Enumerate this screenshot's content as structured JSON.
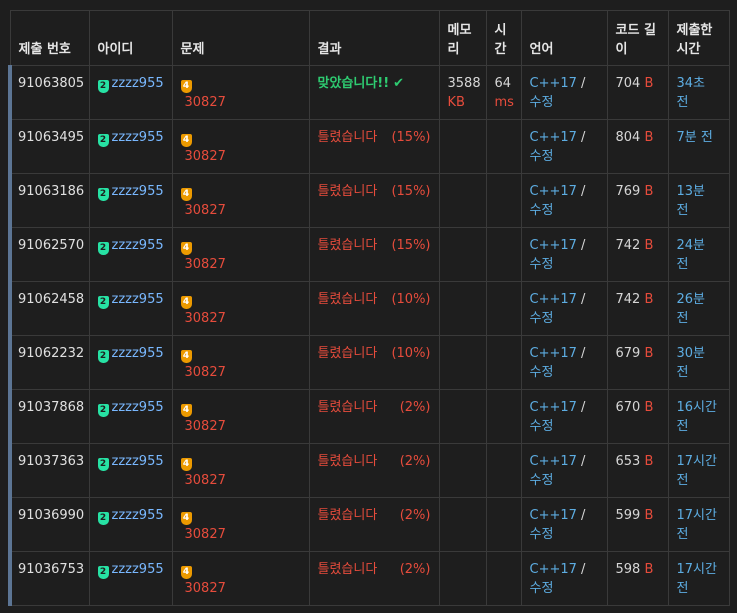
{
  "headers": {
    "submission_id": "제출 번호",
    "user_id": "아이디",
    "problem": "문제",
    "result": "결과",
    "memory": "메모리",
    "time": "시간",
    "language": "언어",
    "code_length": "코드 길이",
    "submitted_at": "제출한 시간"
  },
  "colors": {
    "accepted": "#2ecc71",
    "wrong": "#e74c3c",
    "link": "#79b8ff",
    "user_tier": "#27e2a4",
    "problem_tier": "#ec9a00",
    "row_marker": "#5c7594"
  },
  "rows": [
    {
      "id": "91063805",
      "tier": "2",
      "user": "zzzz955",
      "ptier": "4",
      "problem": "30827",
      "result": "맞았습니다!!",
      "ok": true,
      "pct": "",
      "mem": "3588",
      "mem_unit": "KB",
      "time": "64",
      "time_unit": "ms",
      "lang": "C++17",
      "sep": " / ",
      "edit": "수정",
      "len": "704",
      "unit": "B",
      "ago": "34초 전"
    },
    {
      "id": "91063495",
      "tier": "2",
      "user": "zzzz955",
      "ptier": "4",
      "problem": "30827",
      "result": "틀렸습니다",
      "ok": false,
      "pct": "(15%)",
      "mem": "",
      "mem_unit": "",
      "time": "",
      "time_unit": "",
      "lang": "C++17",
      "sep": " / ",
      "edit": "수정",
      "len": "804",
      "unit": "B",
      "ago": "7분 전"
    },
    {
      "id": "91063186",
      "tier": "2",
      "user": "zzzz955",
      "ptier": "4",
      "problem": "30827",
      "result": "틀렸습니다",
      "ok": false,
      "pct": "(15%)",
      "mem": "",
      "mem_unit": "",
      "time": "",
      "time_unit": "",
      "lang": "C++17",
      "sep": " / ",
      "edit": "수정",
      "len": "769",
      "unit": "B",
      "ago": "13분 전"
    },
    {
      "id": "91062570",
      "tier": "2",
      "user": "zzzz955",
      "ptier": "4",
      "problem": "30827",
      "result": "틀렸습니다",
      "ok": false,
      "pct": "(15%)",
      "mem": "",
      "mem_unit": "",
      "time": "",
      "time_unit": "",
      "lang": "C++17",
      "sep": " / ",
      "edit": "수정",
      "len": "742",
      "unit": "B",
      "ago": "24분 전"
    },
    {
      "id": "91062458",
      "tier": "2",
      "user": "zzzz955",
      "ptier": "4",
      "problem": "30827",
      "result": "틀렸습니다",
      "ok": false,
      "pct": "(10%)",
      "mem": "",
      "mem_unit": "",
      "time": "",
      "time_unit": "",
      "lang": "C++17",
      "sep": " / ",
      "edit": "수정",
      "len": "742",
      "unit": "B",
      "ago": "26분 전"
    },
    {
      "id": "91062232",
      "tier": "2",
      "user": "zzzz955",
      "ptier": "4",
      "problem": "30827",
      "result": "틀렸습니다",
      "ok": false,
      "pct": "(10%)",
      "mem": "",
      "mem_unit": "",
      "time": "",
      "time_unit": "",
      "lang": "C++17",
      "sep": " / ",
      "edit": "수정",
      "len": "679",
      "unit": "B",
      "ago": "30분 전"
    },
    {
      "id": "91037868",
      "tier": "2",
      "user": "zzzz955",
      "ptier": "4",
      "problem": "30827",
      "result": "틀렸습니다",
      "ok": false,
      "pct": "(2%)",
      "mem": "",
      "mem_unit": "",
      "time": "",
      "time_unit": "",
      "lang": "C++17",
      "sep": " / ",
      "edit": "수정",
      "len": "670",
      "unit": "B",
      "ago": "16시간 전"
    },
    {
      "id": "91037363",
      "tier": "2",
      "user": "zzzz955",
      "ptier": "4",
      "problem": "30827",
      "result": "틀렸습니다",
      "ok": false,
      "pct": "(2%)",
      "mem": "",
      "mem_unit": "",
      "time": "",
      "time_unit": "",
      "lang": "C++17",
      "sep": " / ",
      "edit": "수정",
      "len": "653",
      "unit": "B",
      "ago": "17시간 전"
    },
    {
      "id": "91036990",
      "tier": "2",
      "user": "zzzz955",
      "ptier": "4",
      "problem": "30827",
      "result": "틀렸습니다",
      "ok": false,
      "pct": "(2%)",
      "mem": "",
      "mem_unit": "",
      "time": "",
      "time_unit": "",
      "lang": "C++17",
      "sep": " / ",
      "edit": "수정",
      "len": "599",
      "unit": "B",
      "ago": "17시간 전"
    },
    {
      "id": "91036753",
      "tier": "2",
      "user": "zzzz955",
      "ptier": "4",
      "problem": "30827",
      "result": "틀렸습니다",
      "ok": false,
      "pct": "(2%)",
      "mem": "",
      "mem_unit": "",
      "time": "",
      "time_unit": "",
      "lang": "C++17",
      "sep": " / ",
      "edit": "수정",
      "len": "598",
      "unit": "B",
      "ago": "17시간 전"
    }
  ]
}
